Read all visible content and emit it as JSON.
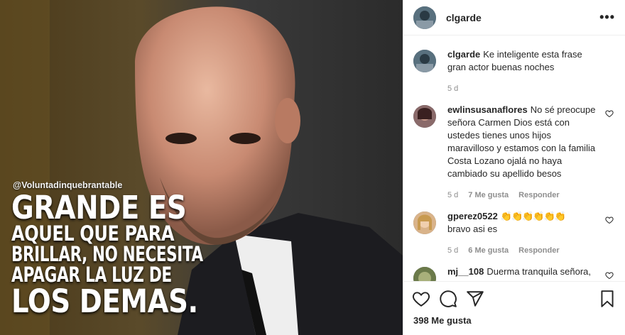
{
  "media": {
    "watermark": "@Voluntadinquebrantable",
    "quote_lines": [
      "GRANDE ES",
      "AQUEL QUE PARA",
      "BRILLAR, NO NECESITA",
      "APAGAR LA LUZ DE",
      "LOS DEMAS."
    ]
  },
  "header": {
    "username": "clgarde",
    "more_label": "•••"
  },
  "comments": [
    {
      "user": "clgarde",
      "text": "Ke inteligente esta frase gran actor buenas noches",
      "time": "5 d",
      "likes": "",
      "reply": ""
    },
    {
      "user": "ewlinsusanaflores",
      "text": "No sé preocupe señora Carmen Dios está con ustedes tienes unos hijos maravilloso y estamos con la familia Costa Lozano ojalá no haya cambiado su apellido besos",
      "time": "5 d",
      "likes": "7 Me gusta",
      "reply": "Responder"
    },
    {
      "user": "gperez0522",
      "emoji": "👏👏👏👏👏👏",
      "text": "bravo asi es",
      "time": "5 d",
      "likes": "6 Me gusta",
      "reply": "Responder"
    },
    {
      "user": "mj__108",
      "text": "Duerma tranquila señora,",
      "time": "",
      "likes": "",
      "reply": ""
    }
  ],
  "footer": {
    "likes_count": "398 Me gusta"
  },
  "colors": {
    "text": "#262626",
    "muted": "#8e8e8e",
    "border": "#efefef"
  }
}
